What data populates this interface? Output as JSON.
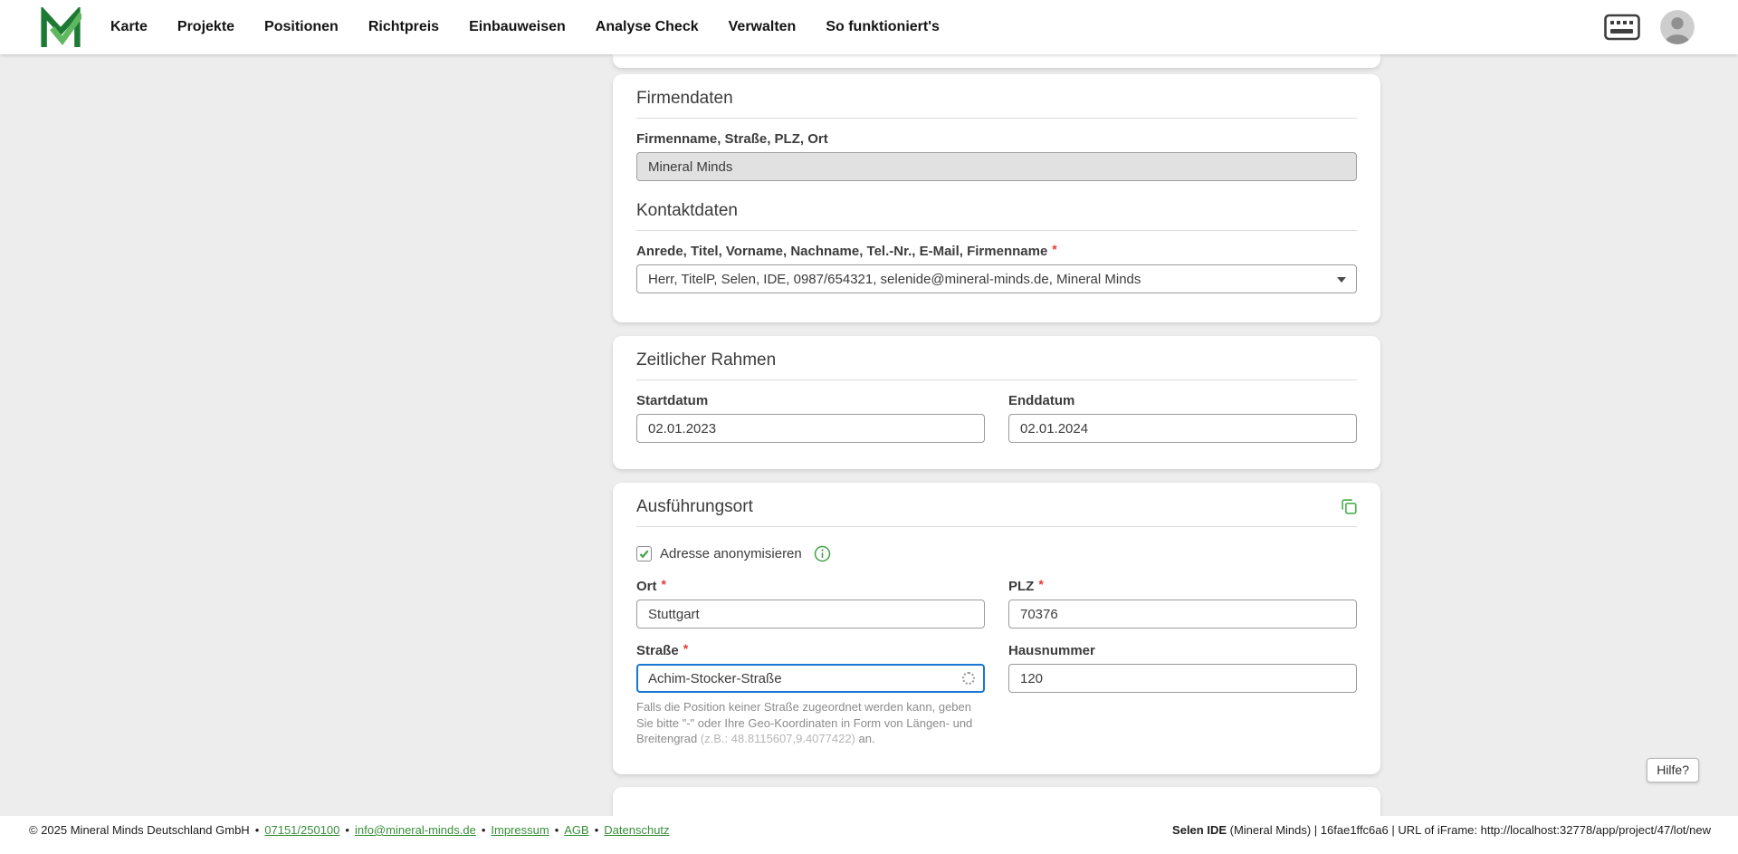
{
  "header": {
    "nav": [
      "Karte",
      "Projekte",
      "Positionen",
      "Richtpreis",
      "Einbauweisen",
      "Analyse Check",
      "Verwalten",
      "So funktioniert's"
    ]
  },
  "required_marker": "*",
  "cards": {
    "firmendaten": {
      "title": "Firmendaten",
      "company_label": "Firmenname, Straße, PLZ, Ort",
      "company_value": "Mineral Minds",
      "contact_title": "Kontaktdaten",
      "contact_label": "Anrede, Titel, Vorname, Nachname, Tel.-Nr., E-Mail, Firmenname",
      "contact_value": "Herr, TitelP, Selen, IDE, 0987/654321, selenide@mineral-minds.de, Mineral Minds"
    },
    "zeitraum": {
      "title": "Zeitlicher Rahmen",
      "start_label": "Startdatum",
      "start_value": "02.01.2023",
      "end_label": "Enddatum",
      "end_value": "02.01.2024"
    },
    "ausfuehrungsort": {
      "title": "Ausführungsort",
      "anonymize_label": "Adresse anonymisieren",
      "ort_label": "Ort",
      "ort_value": "Stuttgart",
      "plz_label": "PLZ",
      "plz_value": "70376",
      "strasse_label": "Straße",
      "strasse_value": "Achim-Stocker-Straße",
      "hausnummer_label": "Hausnummer",
      "hausnummer_value": "120",
      "hint_text": "Falls die Position keiner Straße zugeordnet werden kann, geben Sie bitte \"-\" oder Ihre Geo-Koordinaten in Form von Längen- und Breitengrad ",
      "hint_example": "(z.B.: 48.8115607,9.4077422)",
      "hint_suffix": " an."
    }
  },
  "help_button_label": "Hilfe?",
  "footer": {
    "copyright": "© 2025 Mineral Minds Deutschland GmbH",
    "separator": "•",
    "phone_link": "07151/250100",
    "email_link": "info@mineral-minds.de",
    "impressum_link": "Impressum",
    "agb_link": "AGB",
    "datenschutz_link": "Datenschutz",
    "right_app": "Selen IDE",
    "right_info": " (Mineral Minds) | 16fae1ffc6a6 | URL of iFrame: http://localhost:32778/app/project/47/lot/new"
  },
  "icons": {
    "logo": "mineral-minds-logo",
    "device": "terminal-icon",
    "avatar": "user-avatar-icon",
    "select_caret": "caret-down-icon",
    "copy": "copy-icon",
    "checkbox_check": "check-icon",
    "info": "info-icon",
    "loading": "loading-spinner-icon"
  },
  "colors": {
    "brand_green_dark": "#1d7a34",
    "brand_green_light": "#5fb760",
    "accent_green": "#43a047",
    "focus_blue": "#1976d2",
    "required_red": "#e53935",
    "link_green": "#388e3c",
    "page_background": "#ededed"
  }
}
